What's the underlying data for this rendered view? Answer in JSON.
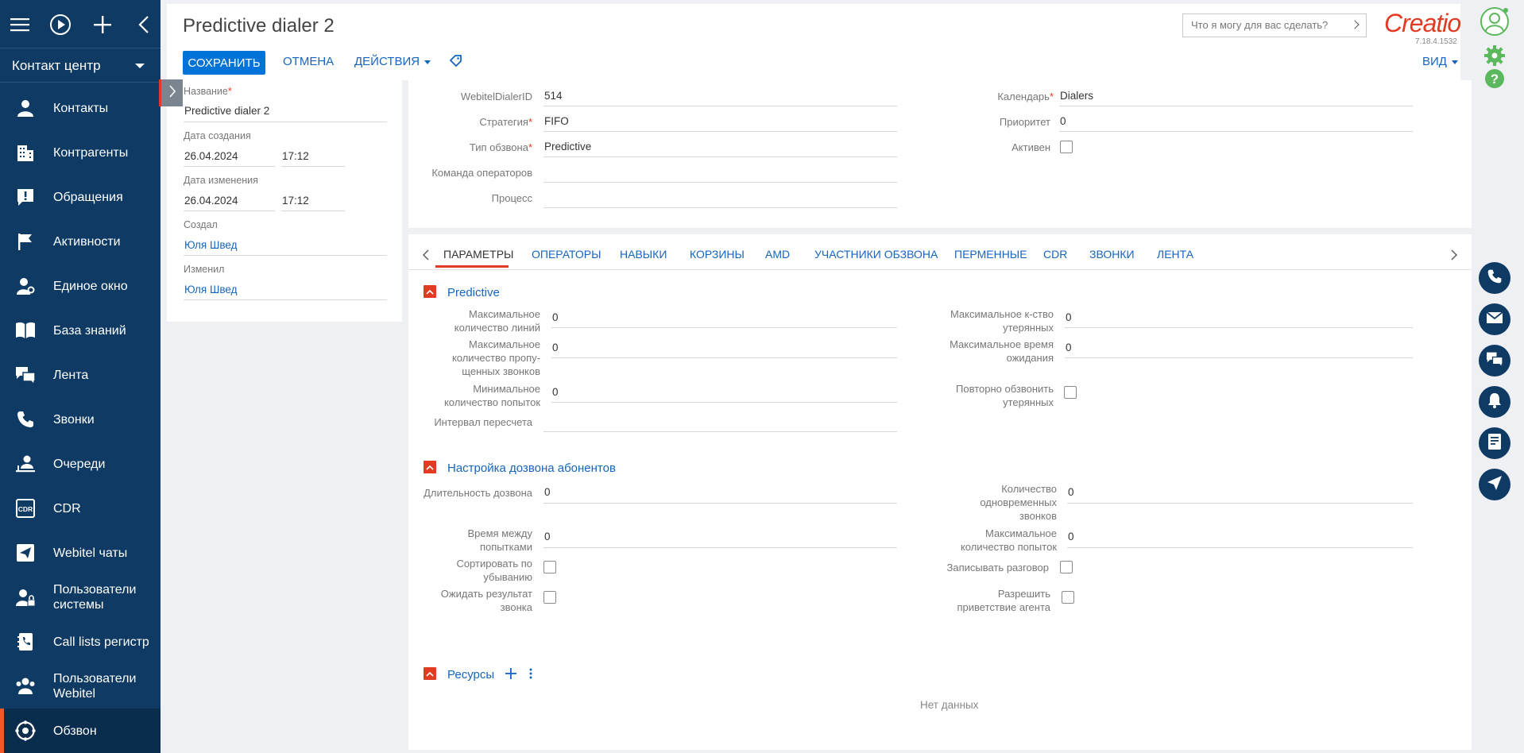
{
  "nav": {
    "workplace": "Контакт центр",
    "items": [
      {
        "label": "Контакты",
        "icon": "person-icon"
      },
      {
        "label": "Контрагенты",
        "icon": "building-icon"
      },
      {
        "label": "Обращения",
        "icon": "exclamation-icon"
      },
      {
        "label": "Активности",
        "icon": "flag-icon"
      },
      {
        "label": "Единое окно",
        "icon": "person-settings-icon"
      },
      {
        "label": "База знаний",
        "icon": "book-icon"
      },
      {
        "label": "Лента",
        "icon": "chat-icon"
      },
      {
        "label": "Звонки",
        "icon": "phone-icon"
      },
      {
        "label": "Очереди",
        "icon": "queue-icon"
      },
      {
        "label": "CDR",
        "icon": "cdr-icon"
      },
      {
        "label": "Webitel чаты",
        "icon": "paper-plane-icon"
      },
      {
        "label": "Пользователи системы",
        "icon": "user-lock-icon"
      },
      {
        "label": "Call lists регистр",
        "icon": "contact-book-icon"
      },
      {
        "label": "Пользователи Webitel",
        "icon": "users-icon"
      },
      {
        "label": "Обзвон",
        "icon": "dialer-icon"
      }
    ]
  },
  "header": {
    "title": "Predictive dialer 2",
    "save": "СОХРАНИТЬ",
    "cancel": "ОТМЕНА",
    "actions": "ДЕЙСТВИЯ",
    "search_placeholder": "Что я могу для вас сделать?",
    "logo": "Creatio",
    "version": "7.18.4.1532",
    "view": "ВИД"
  },
  "info": {
    "name_label": "Название",
    "name_value": "Predictive dialer 2",
    "created_label": "Дата создания",
    "created_date": "26.04.2024",
    "created_time": "17:12",
    "modified_label": "Дата изменения",
    "modified_date": "26.04.2024",
    "modified_time": "17:12",
    "created_by_label": "Создал",
    "created_by": "Юля Швед",
    "modified_by_label": "Изменил",
    "modified_by": "Юля Швед"
  },
  "main": {
    "dialer_id_label": "WebitelDialerID",
    "dialer_id": "514",
    "strategy_label": "Стратегия",
    "strategy": "FIFO",
    "type_label": "Тип обзвона",
    "type": "Predictive",
    "team_label": "Команда операторов",
    "team": "",
    "process_label": "Процесс",
    "process": "",
    "calendar_label": "Календарь",
    "calendar": "Dialers",
    "priority_label": "Приоритет",
    "priority": "0",
    "active_label": "Активен"
  },
  "tabs": [
    "ПАРАМЕТРЫ",
    "ОПЕРАТОРЫ",
    "НАВЫКИ",
    "КОРЗИНЫ",
    "AMD",
    "УЧАСТНИКИ ОБЗВОНА",
    "ПЕРМЕННЫЕ",
    "CDR",
    "ЗВОНКИ",
    "ЛЕНТА"
  ],
  "predictive": {
    "title": "Predictive",
    "max_lines_label": "Максимальное количество линий",
    "max_lines": "0",
    "max_missed_label": "Максимальное количество пропу-щенных звонков",
    "max_missed": "0",
    "min_attempts_label": "Минимальное количество попыток",
    "min_attempts": "0",
    "recalc_label": "Интервал пересчета",
    "recalc": "",
    "max_lost_label": "Максимальное к-ство утерянных",
    "max_lost": "0",
    "max_wait_label": "Максимальное время ожидания",
    "max_wait": "0",
    "redial_lost_label": "Повторно обзвонить утерянных"
  },
  "dial": {
    "title": "Настройка дозвона абонентов",
    "duration_label": "Длительность дозвона",
    "duration": "0",
    "between_label": "Время между попытками",
    "between": "0",
    "sort_desc_label": "Сортировать по убыванию",
    "await_result_label": "Ожидать результат звонка",
    "simultaneous_label": "Количество одновременных звонков",
    "simultaneous": "0",
    "max_attempts_label": "Максимальное количество попыток",
    "max_attempts": "0",
    "record_label": "Записывать разговор",
    "agent_greeting_label": "Разрешить приветствие агента"
  },
  "resources": {
    "title": "Ресурсы",
    "empty": "Нет данных"
  }
}
